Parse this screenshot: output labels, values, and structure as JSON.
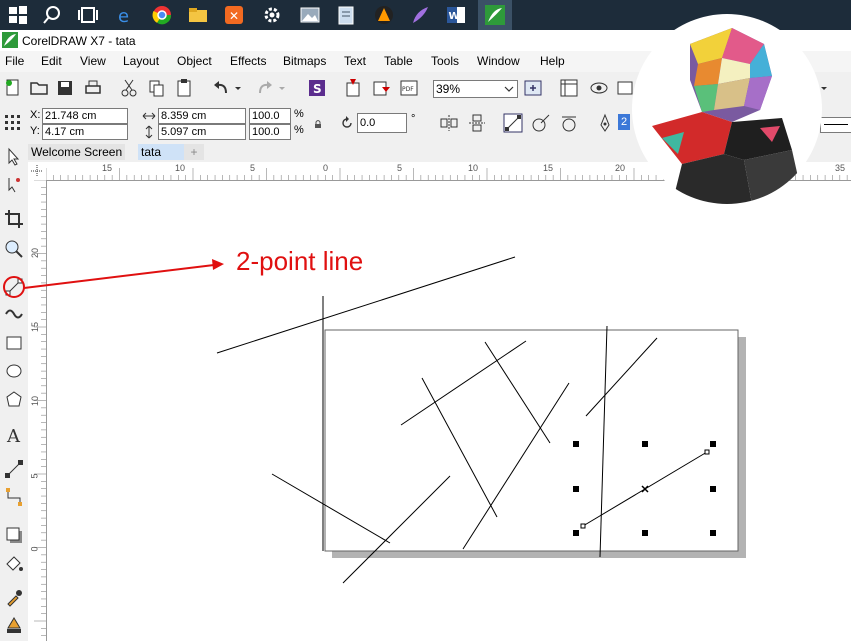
{
  "window": {
    "title": "CorelDRAW X7 - tata"
  },
  "menu": [
    "File",
    "Edit",
    "View",
    "Layout",
    "Object",
    "Effects",
    "Bitmaps",
    "Text",
    "Table",
    "Tools",
    "Window",
    "Help"
  ],
  "toolbar": {
    "zoom": "39%"
  },
  "property_bar": {
    "x_label": "X:",
    "x_value": "21.748 cm",
    "y_label": "Y:",
    "y_value": "4.17 cm",
    "width_value": "8.359 cm",
    "height_value": "5.097 cm",
    "scale_w": "100.0",
    "scale_h": "100.0",
    "pct1": "%",
    "pct2": "%",
    "angle_value": "0.0",
    "degree": "°",
    "outline_value": "2"
  },
  "tabs": [
    {
      "label": "Welcome Screen"
    },
    {
      "label": "tata"
    }
  ],
  "rulers": {
    "horizontal": [
      "15",
      "10",
      "5",
      "0",
      "5",
      "10",
      "15",
      "20",
      "35"
    ],
    "vertical": [
      "20",
      "15",
      "10",
      "5",
      "0"
    ]
  },
  "annotation": {
    "text": "2-point line",
    "color": "#e01010"
  },
  "colors": {
    "taskbar": "#1d2c3a",
    "accent_green": "#2e9a3a",
    "annotation": "#e01010"
  }
}
